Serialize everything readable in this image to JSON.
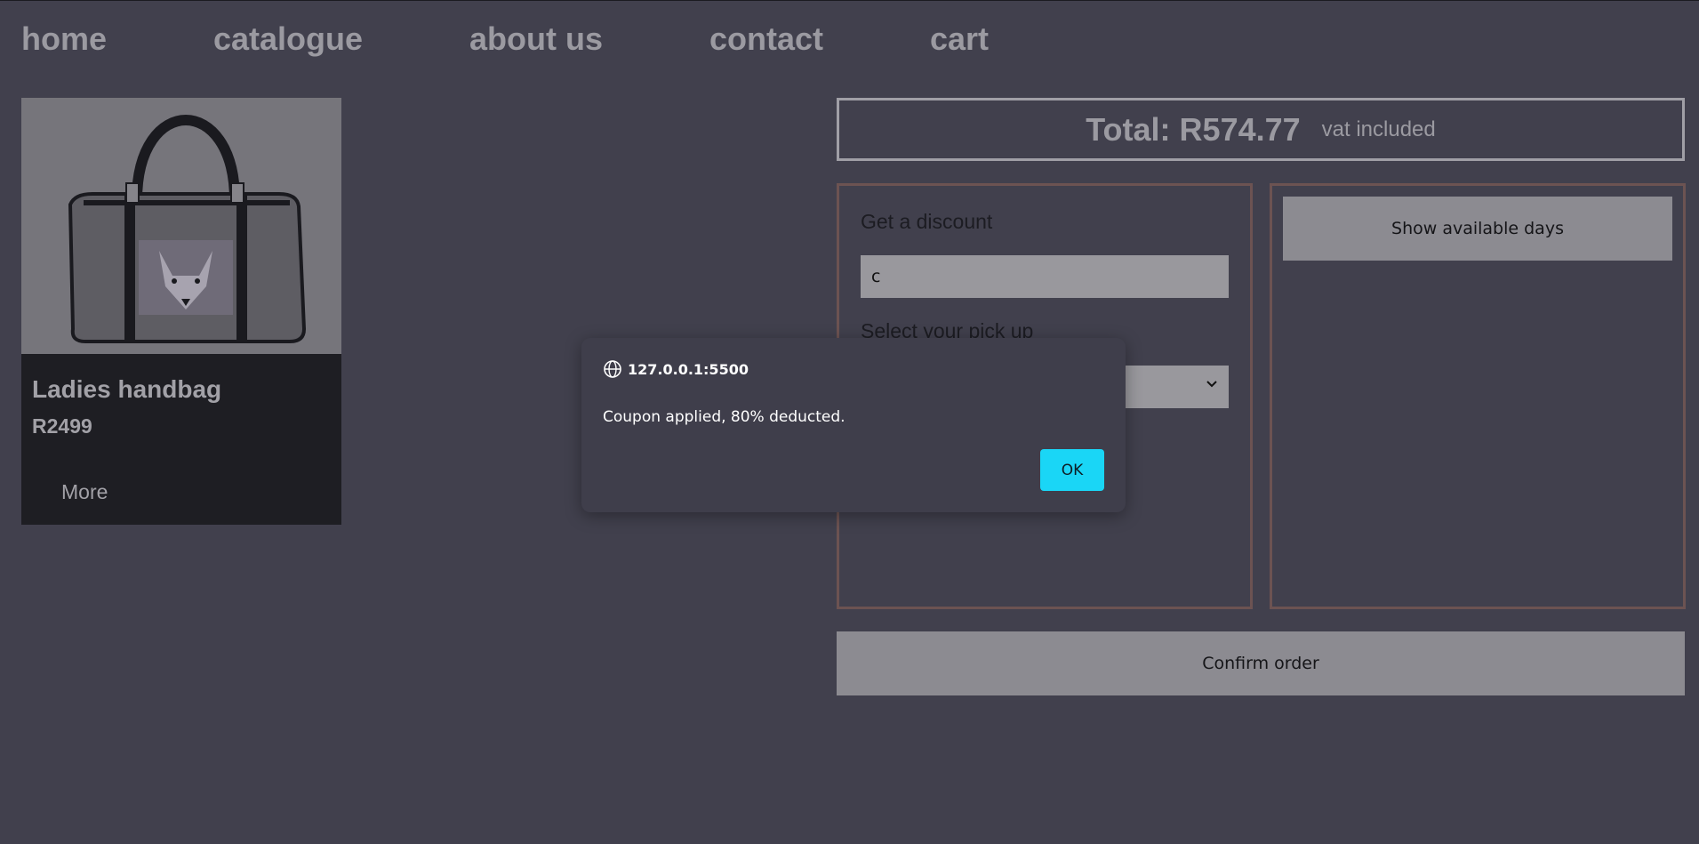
{
  "nav": {
    "items": [
      {
        "label": "home"
      },
      {
        "label": "catalogue"
      },
      {
        "label": "about us"
      },
      {
        "label": "contact"
      },
      {
        "label": "cart"
      }
    ]
  },
  "product": {
    "title": "Ladies handbag",
    "price": "R2499",
    "more_label": "More",
    "image_icon": "handbag-image"
  },
  "cart_summary": {
    "total": "Total: R574.77",
    "vat_note": "vat included"
  },
  "discount_panel": {
    "heading": "Get a discount",
    "coupon_value": "c",
    "pickup_heading": "Select your pick up",
    "pickup_selected": ""
  },
  "schedule_panel": {
    "show_days_label": "Show available days"
  },
  "confirm_label": "Confirm order",
  "dialog": {
    "origin": "127.0.0.1:5500",
    "message": "Coupon applied, 80% deducted.",
    "ok_label": "OK",
    "origin_icon": "globe-icon"
  },
  "colors": {
    "background": "#41404d",
    "nav_text": "#9b9aa1",
    "panel_border": "#6c5352",
    "button_bg": "#8c8b91",
    "dialog_bg": "#3f3e4b",
    "dialog_ok_bg": "#1ad6f6"
  }
}
